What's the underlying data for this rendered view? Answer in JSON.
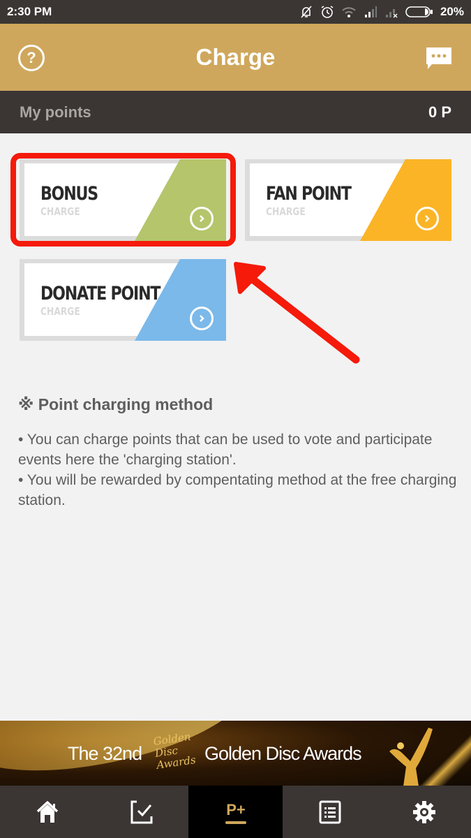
{
  "status_bar": {
    "time": "2:30 PM",
    "battery_percent": "20%",
    "icons": [
      "mute-bell-icon",
      "alarm-icon",
      "wifi-icon",
      "signal-icon",
      "no-signal-icon",
      "battery-icon"
    ]
  },
  "header": {
    "title": "Charge",
    "help_icon": "question-circle-icon",
    "help_glyph": "?",
    "chat_icon": "chat-bubble-icon"
  },
  "points": {
    "label": "My points",
    "value": "0 P"
  },
  "cards": [
    {
      "name": "BONUS",
      "sub": "CHARGE",
      "color": "#b4c56c",
      "highlighted": true
    },
    {
      "name": "FAN POINT",
      "sub": "CHARGE",
      "color": "#fbb426",
      "highlighted": false
    },
    {
      "name": "DONATE POINT",
      "sub": "CHARGE",
      "color": "#7bb9ea",
      "highlighted": false
    }
  ],
  "annotation": {
    "highlight_color": "#f51a0a"
  },
  "info": {
    "heading": "※ Point charging method",
    "lines": [
      "• You can charge points that can be used to vote and participate events here the 'charging station'.",
      "• You will be rewarded by compentating method at the free charging station."
    ]
  },
  "banner": {
    "text_left": "The 32nd",
    "logo_lines": [
      "Golden",
      "Disc",
      "Awards"
    ],
    "text_right": "Golden Disc Awards"
  },
  "tabbar": {
    "active_index": 2,
    "accent_color": "#cfa75c",
    "tabs": [
      {
        "icon": "home-icon"
      },
      {
        "icon": "vote-check-icon"
      },
      {
        "icon": "point-charge-icon",
        "glyph": "P+"
      },
      {
        "icon": "list-icon"
      },
      {
        "icon": "settings-gear-icon"
      }
    ]
  }
}
